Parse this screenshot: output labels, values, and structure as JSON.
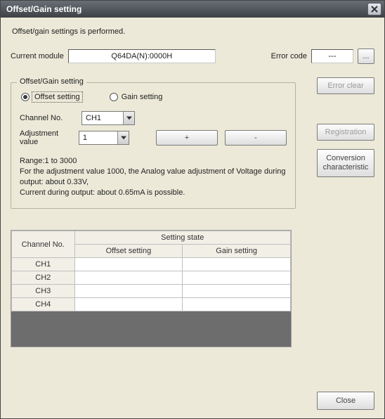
{
  "title": "Offset/Gain setting",
  "description": "Offset/gain settings is performed.",
  "current_module_label": "Current module",
  "current_module_value": "Q64DA(N):0000H",
  "error_code_label": "Error code",
  "error_code_value": "---",
  "ellipsis_label": "...",
  "buttons": {
    "error_clear": "Error clear",
    "registration": "Registration",
    "conversion_characteristic": "Conversion characteristic",
    "plus": "+",
    "minus": "-",
    "close": "Close"
  },
  "group": {
    "legend": "Offset/Gain setting",
    "offset_label": "Offset setting",
    "gain_label": "Gain setting",
    "channel_label": "Channel No.",
    "channel_value": "CH1",
    "adjust_label": "Adjustment value",
    "adjust_value": "1",
    "hint1": "Range:1 to 3000",
    "hint2": "For the adjustment value 1000, the Analog value adjustment of Voltage during output: about 0.33V,",
    "hint3": "Current during output: about 0.65mA is possible."
  },
  "table": {
    "col_channel": "Channel No.",
    "col_state": "Setting state",
    "col_offset": "Offset setting",
    "col_gain": "Gain setting",
    "rows": [
      "CH1",
      "CH2",
      "CH3",
      "CH4"
    ]
  }
}
